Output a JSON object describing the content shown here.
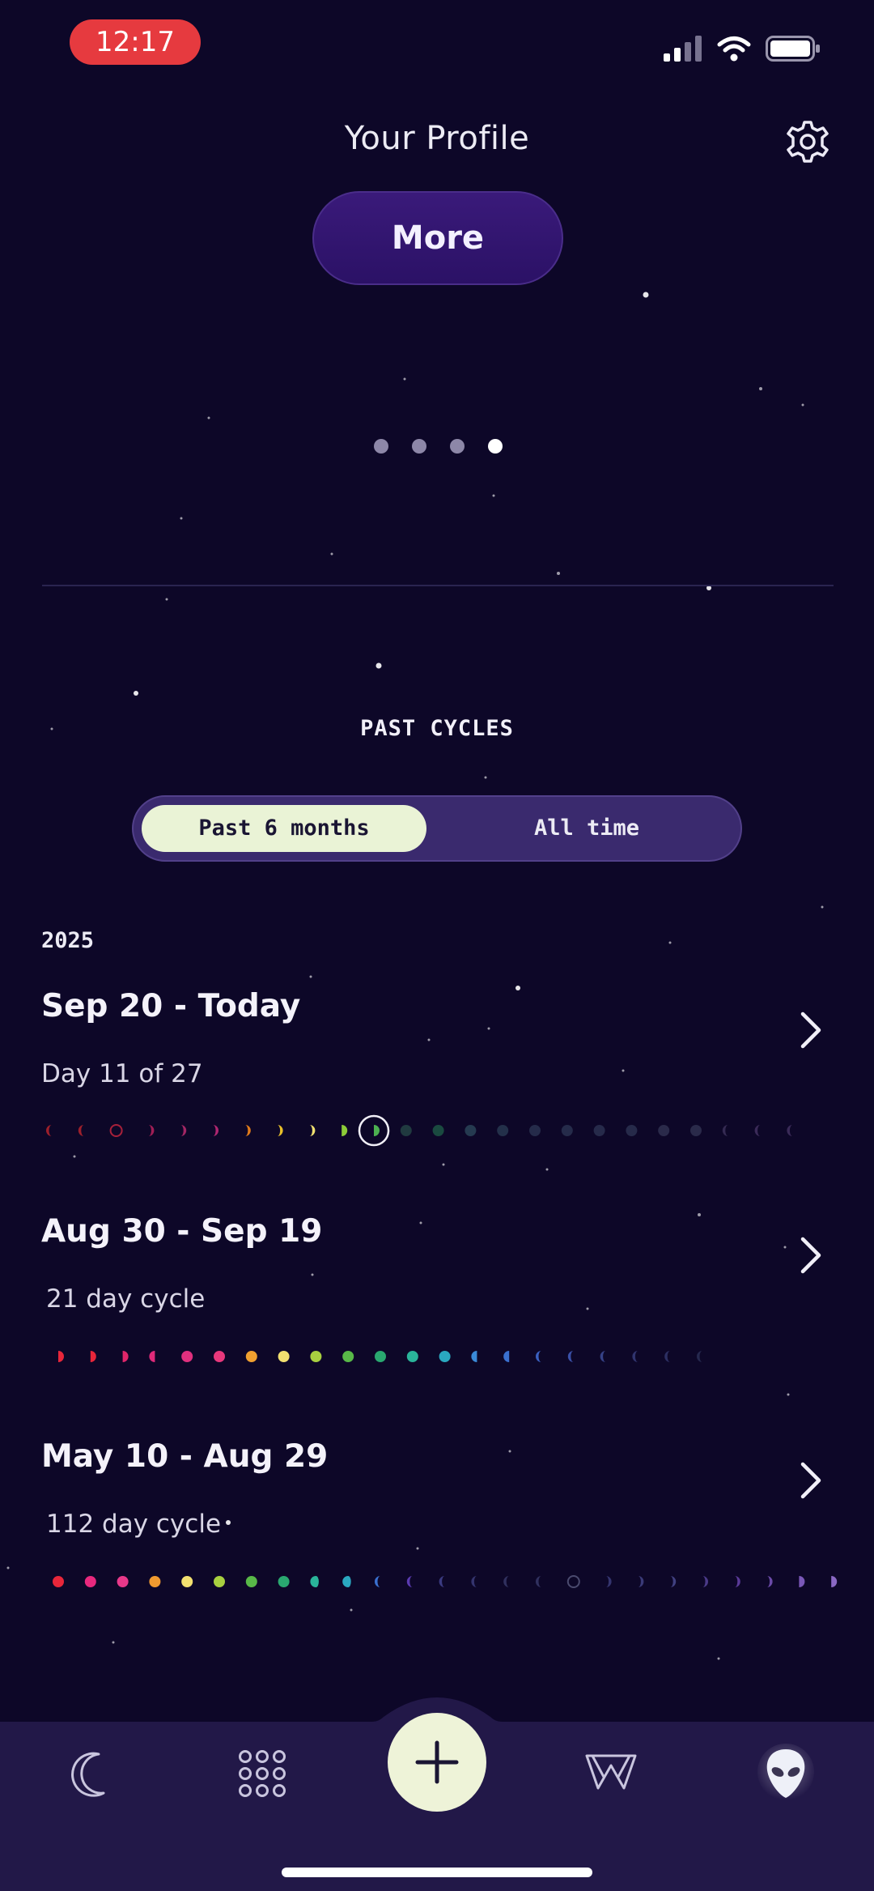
{
  "status_bar": {
    "time": "12:17"
  },
  "header": {
    "title": "Your Profile",
    "more_label": "More"
  },
  "pager": {
    "count": 4,
    "active_index": 3
  },
  "past_cycles": {
    "section_title": "PAST CYCLES",
    "segmented": {
      "options": [
        "Past 6 months",
        "All time"
      ],
      "selected_index": 0
    },
    "year": "2025",
    "cycles": [
      {
        "title": "Sep 20 - Today",
        "subtitle": "Day 11 of 27"
      },
      {
        "title": "Aug 30 - Sep 19",
        "subtitle": "21 day cycle"
      },
      {
        "title": "May 10 - Aug 29",
        "subtitle": "112 day cycle"
      }
    ]
  },
  "bottom_nav": {
    "items": [
      {
        "name": "cycle",
        "icon": "moon-icon"
      },
      {
        "name": "grid",
        "icon": "dots-grid-icon"
      },
      {
        "name": "add",
        "icon": "plus-icon"
      },
      {
        "name": "learn",
        "icon": "w-icon"
      },
      {
        "name": "profile",
        "icon": "alien-icon",
        "active": true
      }
    ]
  },
  "colors": {
    "background": "#0d0728",
    "accent": "#2b1166",
    "selected_pill": "#eaf3d6",
    "nav_bg": "#221848",
    "status_pill": "#e63a3f"
  }
}
